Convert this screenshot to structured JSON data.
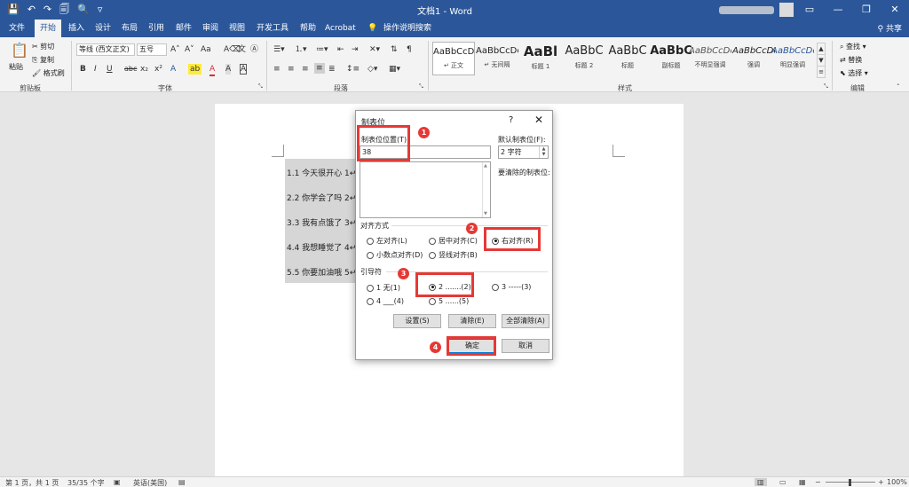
{
  "window": {
    "title": "文档1 - Word",
    "quick_access": [
      "💾",
      "↶",
      "↷",
      "🗐",
      "🔍",
      "▿"
    ]
  },
  "ribbon_tabs": [
    "文件",
    "开始",
    "插入",
    "设计",
    "布局",
    "引用",
    "邮件",
    "审阅",
    "视图",
    "开发工具",
    "帮助",
    "Acrobat"
  ],
  "active_tab": "开始",
  "tell_me": "操作说明搜索",
  "share": "共享",
  "clipboard": {
    "paste": "粘贴",
    "cut": "剪切",
    "copy": "复制",
    "format_painter": "格式刷",
    "group": "剪贴板"
  },
  "font": {
    "name": "等线 (西文正文)",
    "size": "五号",
    "group": "字体",
    "buttons": [
      "B",
      "I",
      "U",
      "abc",
      "x₂",
      "x²"
    ]
  },
  "paragraph": {
    "group": "段落"
  },
  "styles": {
    "group": "样式",
    "items": [
      {
        "preview": "AaBbCcDc",
        "name": "↵ 正文",
        "selected": true
      },
      {
        "preview": "AaBbCcDc",
        "name": "↵ 无间隔"
      },
      {
        "preview": "AaBl",
        "name": "标题 1"
      },
      {
        "preview": "AaBbC",
        "name": "标题 2"
      },
      {
        "preview": "AaBbC",
        "name": "标题"
      },
      {
        "preview": "AaBbC",
        "name": "副标题"
      },
      {
        "preview": "AaBbCcDc",
        "name": "不明显强调"
      },
      {
        "preview": "AaBbCcDc",
        "name": "强调"
      },
      {
        "preview": "AaBbCcDc",
        "name": "明显强调"
      }
    ]
  },
  "editing": {
    "find": "查找",
    "replace": "替换",
    "select": "选择",
    "group": "编辑"
  },
  "document": {
    "lines": [
      "1.1 今天很开心 1↵",
      "2.2 你学会了吗 2↵",
      "3.3 我有点饿了 3↵",
      "4.4 我想睡觉了 4↵",
      "5.5 你要加油哦 5↵"
    ]
  },
  "dialog": {
    "title": "制表位",
    "help": "?",
    "close": "✕",
    "tab_position_label": "制表位位置(T):",
    "tab_position_value": "38",
    "default_tab_label": "默认制表位(F):",
    "default_tab_value": "2 字符",
    "to_clear_label": "要清除的制表位:",
    "alignment_label": "对齐方式",
    "alignment_options": [
      {
        "label": "左对齐(L)",
        "selected": false
      },
      {
        "label": "居中对齐(C)",
        "selected": false
      },
      {
        "label": "右对齐(R)",
        "selected": true
      },
      {
        "label": "小数点对齐(D)",
        "selected": false
      },
      {
        "label": "竖线对齐(B)",
        "selected": false
      }
    ],
    "leader_label": "引导符",
    "leader_options": [
      {
        "label": "1 无(1)",
        "selected": false
      },
      {
        "label": "2 .......(2)",
        "selected": true
      },
      {
        "label": "3 -----(3)",
        "selected": false
      },
      {
        "label": "4 ___(4)",
        "selected": false
      },
      {
        "label": "5 ......(5)",
        "selected": false
      }
    ],
    "set_button": "设置(S)",
    "clear_button": "清除(E)",
    "clear_all_button": "全部清除(A)",
    "ok_button": "确定",
    "cancel_button": "取消"
  },
  "annotations": [
    "1",
    "2",
    "3",
    "4"
  ],
  "status": {
    "page": "第 1 页，共 1 页",
    "words": "35/35 个字",
    "language": "英语(美国)",
    "zoom": "100%",
    "zoom_minus": "−",
    "zoom_plus": "+"
  },
  "colors": {
    "word_blue": "#2b579a",
    "annotation_red": "#e53935",
    "ribbon_bg": "#f3f3f3"
  }
}
